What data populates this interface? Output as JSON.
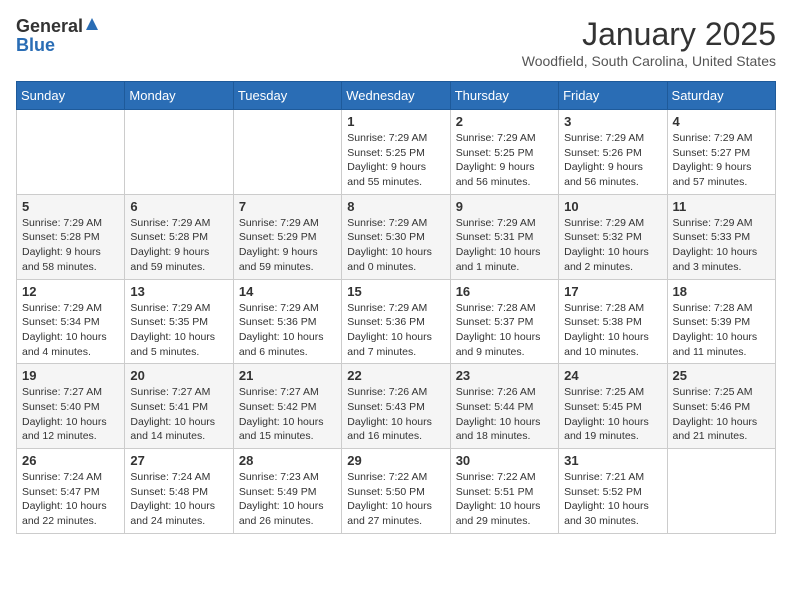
{
  "header": {
    "logo_general": "General",
    "logo_blue": "Blue",
    "month_title": "January 2025",
    "location": "Woodfield, South Carolina, United States"
  },
  "weekdays": [
    "Sunday",
    "Monday",
    "Tuesday",
    "Wednesday",
    "Thursday",
    "Friday",
    "Saturday"
  ],
  "weeks": [
    [
      {
        "day": "",
        "info": ""
      },
      {
        "day": "",
        "info": ""
      },
      {
        "day": "",
        "info": ""
      },
      {
        "day": "1",
        "info": "Sunrise: 7:29 AM\nSunset: 5:25 PM\nDaylight: 9 hours\nand 55 minutes."
      },
      {
        "day": "2",
        "info": "Sunrise: 7:29 AM\nSunset: 5:25 PM\nDaylight: 9 hours\nand 56 minutes."
      },
      {
        "day": "3",
        "info": "Sunrise: 7:29 AM\nSunset: 5:26 PM\nDaylight: 9 hours\nand 56 minutes."
      },
      {
        "day": "4",
        "info": "Sunrise: 7:29 AM\nSunset: 5:27 PM\nDaylight: 9 hours\nand 57 minutes."
      }
    ],
    [
      {
        "day": "5",
        "info": "Sunrise: 7:29 AM\nSunset: 5:28 PM\nDaylight: 9 hours\nand 58 minutes."
      },
      {
        "day": "6",
        "info": "Sunrise: 7:29 AM\nSunset: 5:28 PM\nDaylight: 9 hours\nand 59 minutes."
      },
      {
        "day": "7",
        "info": "Sunrise: 7:29 AM\nSunset: 5:29 PM\nDaylight: 9 hours\nand 59 minutes."
      },
      {
        "day": "8",
        "info": "Sunrise: 7:29 AM\nSunset: 5:30 PM\nDaylight: 10 hours\nand 0 minutes."
      },
      {
        "day": "9",
        "info": "Sunrise: 7:29 AM\nSunset: 5:31 PM\nDaylight: 10 hours\nand 1 minute."
      },
      {
        "day": "10",
        "info": "Sunrise: 7:29 AM\nSunset: 5:32 PM\nDaylight: 10 hours\nand 2 minutes."
      },
      {
        "day": "11",
        "info": "Sunrise: 7:29 AM\nSunset: 5:33 PM\nDaylight: 10 hours\nand 3 minutes."
      }
    ],
    [
      {
        "day": "12",
        "info": "Sunrise: 7:29 AM\nSunset: 5:34 PM\nDaylight: 10 hours\nand 4 minutes."
      },
      {
        "day": "13",
        "info": "Sunrise: 7:29 AM\nSunset: 5:35 PM\nDaylight: 10 hours\nand 5 minutes."
      },
      {
        "day": "14",
        "info": "Sunrise: 7:29 AM\nSunset: 5:36 PM\nDaylight: 10 hours\nand 6 minutes."
      },
      {
        "day": "15",
        "info": "Sunrise: 7:29 AM\nSunset: 5:36 PM\nDaylight: 10 hours\nand 7 minutes."
      },
      {
        "day": "16",
        "info": "Sunrise: 7:28 AM\nSunset: 5:37 PM\nDaylight: 10 hours\nand 9 minutes."
      },
      {
        "day": "17",
        "info": "Sunrise: 7:28 AM\nSunset: 5:38 PM\nDaylight: 10 hours\nand 10 minutes."
      },
      {
        "day": "18",
        "info": "Sunrise: 7:28 AM\nSunset: 5:39 PM\nDaylight: 10 hours\nand 11 minutes."
      }
    ],
    [
      {
        "day": "19",
        "info": "Sunrise: 7:27 AM\nSunset: 5:40 PM\nDaylight: 10 hours\nand 12 minutes."
      },
      {
        "day": "20",
        "info": "Sunrise: 7:27 AM\nSunset: 5:41 PM\nDaylight: 10 hours\nand 14 minutes."
      },
      {
        "day": "21",
        "info": "Sunrise: 7:27 AM\nSunset: 5:42 PM\nDaylight: 10 hours\nand 15 minutes."
      },
      {
        "day": "22",
        "info": "Sunrise: 7:26 AM\nSunset: 5:43 PM\nDaylight: 10 hours\nand 16 minutes."
      },
      {
        "day": "23",
        "info": "Sunrise: 7:26 AM\nSunset: 5:44 PM\nDaylight: 10 hours\nand 18 minutes."
      },
      {
        "day": "24",
        "info": "Sunrise: 7:25 AM\nSunset: 5:45 PM\nDaylight: 10 hours\nand 19 minutes."
      },
      {
        "day": "25",
        "info": "Sunrise: 7:25 AM\nSunset: 5:46 PM\nDaylight: 10 hours\nand 21 minutes."
      }
    ],
    [
      {
        "day": "26",
        "info": "Sunrise: 7:24 AM\nSunset: 5:47 PM\nDaylight: 10 hours\nand 22 minutes."
      },
      {
        "day": "27",
        "info": "Sunrise: 7:24 AM\nSunset: 5:48 PM\nDaylight: 10 hours\nand 24 minutes."
      },
      {
        "day": "28",
        "info": "Sunrise: 7:23 AM\nSunset: 5:49 PM\nDaylight: 10 hours\nand 26 minutes."
      },
      {
        "day": "29",
        "info": "Sunrise: 7:22 AM\nSunset: 5:50 PM\nDaylight: 10 hours\nand 27 minutes."
      },
      {
        "day": "30",
        "info": "Sunrise: 7:22 AM\nSunset: 5:51 PM\nDaylight: 10 hours\nand 29 minutes."
      },
      {
        "day": "31",
        "info": "Sunrise: 7:21 AM\nSunset: 5:52 PM\nDaylight: 10 hours\nand 30 minutes."
      },
      {
        "day": "",
        "info": ""
      }
    ]
  ]
}
